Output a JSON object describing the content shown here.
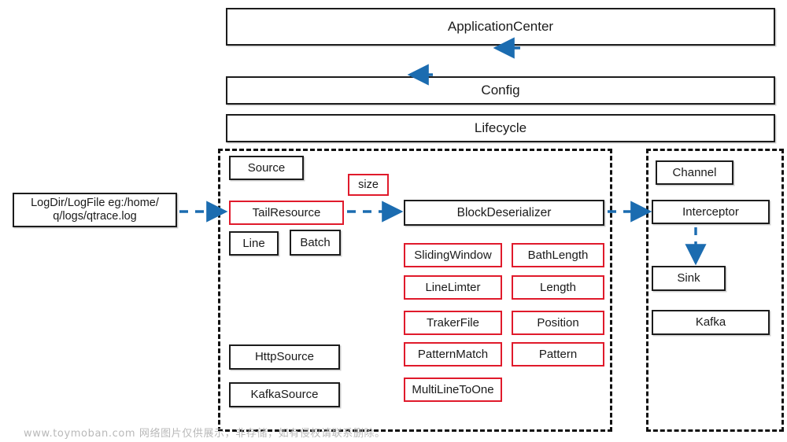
{
  "colors": {
    "accent_blue": "#1b6cb0",
    "red": "#e01a2b",
    "black": "#1c1c1c",
    "watermark_gray": "#b9b9b9",
    "background": "#ffffff"
  },
  "top_stack": [
    {
      "label": "ApplicationCenter",
      "name": "application-center-box"
    },
    {
      "label": "Config",
      "name": "config-box"
    },
    {
      "label": "Lifecycle",
      "name": "lifecycle-box"
    }
  ],
  "input_node": {
    "line1": "LogDir/LogFile  eg:/home/",
    "line2": "q/logs/qtrace.log"
  },
  "source_region": {
    "source": "Source",
    "tail_resource": "TailResource",
    "line": "Line",
    "batch": "Batch",
    "http_source": "HttpSource",
    "kafka_source": "KafkaSource"
  },
  "size_badge": {
    "label": "size"
  },
  "deserializer_region": {
    "title": "BlockDeserializer",
    "left_column": [
      "SlidingWindow",
      "LineLimter",
      "TrakerFile",
      "PatternMatch",
      "MultiLineToOne"
    ],
    "right_column": [
      "BathLength",
      "Length",
      "Position",
      "Pattern"
    ]
  },
  "sink_region": {
    "channel": "Channel",
    "interceptor": "Interceptor",
    "sink": "Sink",
    "kafka": "Kafka"
  },
  "watermark": {
    "text": "www.toymoban.com 网络图片仅供展示，非存储，如有侵权请联系删除。"
  }
}
